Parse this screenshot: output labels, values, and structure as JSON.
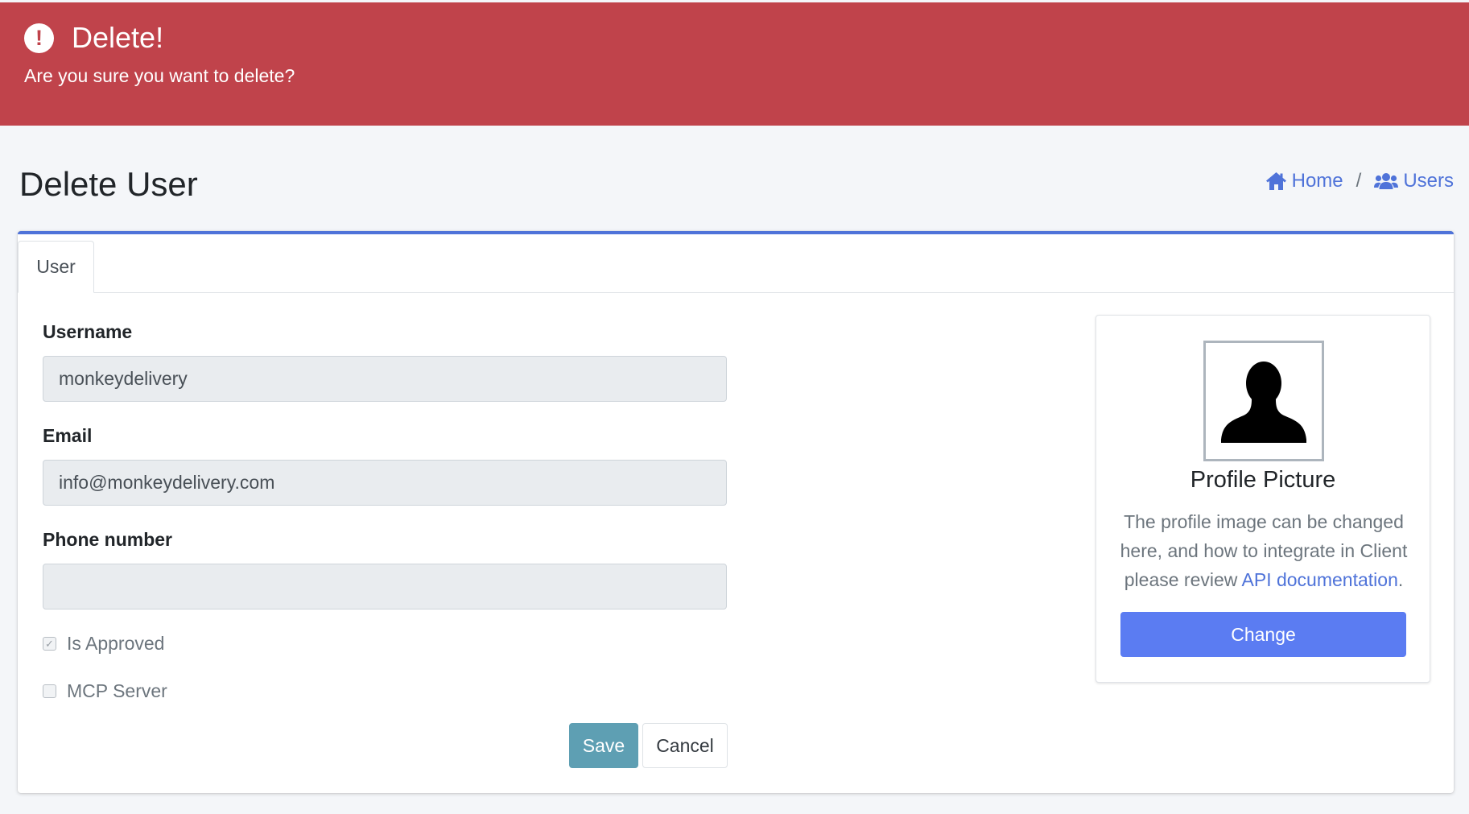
{
  "alert": {
    "title": "Delete!",
    "message": "Are you sure you want to delete?",
    "icon": "exclamation-circle-icon",
    "color": "#c0434b"
  },
  "page": {
    "title": "Delete User"
  },
  "breadcrumb": {
    "home_label": "Home",
    "home_icon": "home-icon",
    "separator": "/",
    "users_label": "Users",
    "users_icon": "users-icon"
  },
  "tabs": [
    {
      "label": "User"
    }
  ],
  "form": {
    "username": {
      "label": "Username",
      "value": "monkeydelivery"
    },
    "email": {
      "label": "Email",
      "value": "info@monkeydelivery.com"
    },
    "phone": {
      "label": "Phone number",
      "value": ""
    },
    "is_approved": {
      "label": "Is Approved",
      "checked": true
    },
    "mcp_server": {
      "label": "MCP Server",
      "checked": false
    },
    "save_label": "Save",
    "cancel_label": "Cancel"
  },
  "profile": {
    "title": "Profile Picture",
    "description": "The profile image can be changed here, and how to integrate in Client please review",
    "link_label": "API documentation",
    "description_end": ".",
    "change_label": "Change",
    "avatar_icon": "user-silhouette-icon"
  },
  "colors": {
    "accent": "#4f73d9",
    "save_button": "#5e9fb3",
    "change_button": "#5b7cf2"
  }
}
